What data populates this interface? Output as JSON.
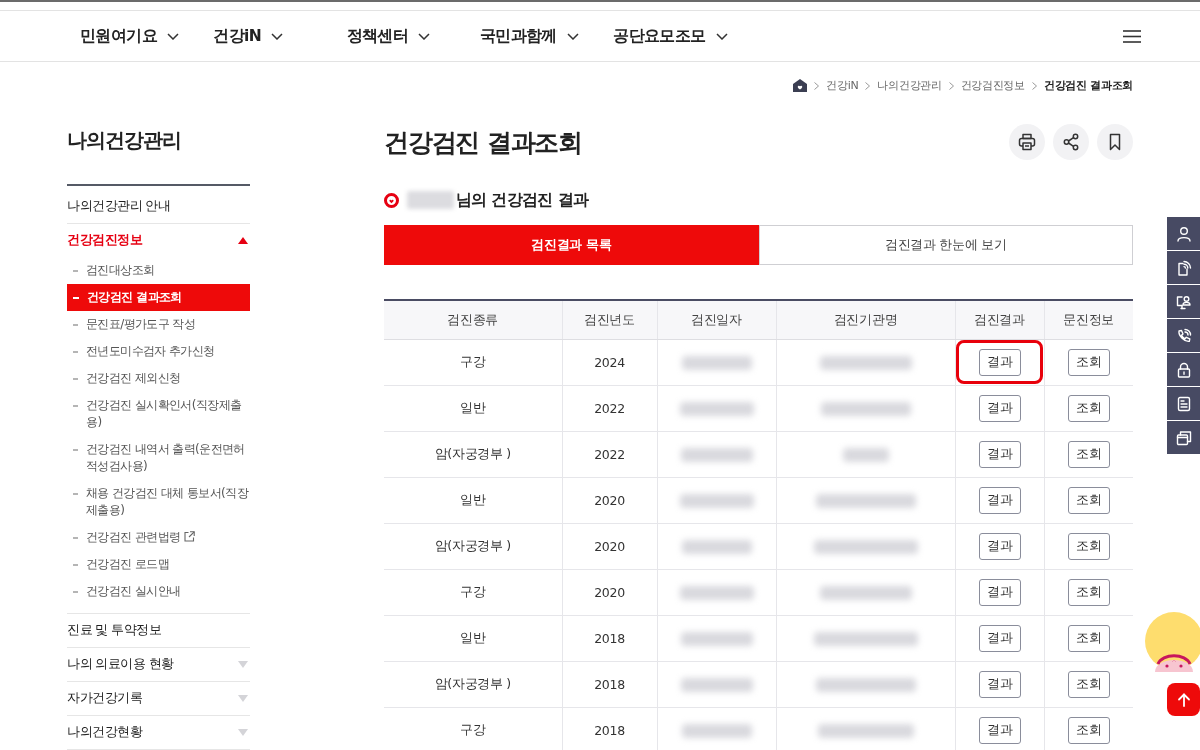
{
  "top_nav": {
    "items": [
      {
        "label": "민원여기요"
      },
      {
        "label": "건강iN"
      },
      {
        "label": "정책센터"
      },
      {
        "label": "국민과함께"
      },
      {
        "label": "공단요모조모"
      }
    ]
  },
  "breadcrumb": [
    {
      "label": "건강iN",
      "current": false
    },
    {
      "label": "나의건강관리",
      "current": false
    },
    {
      "label": "건강검진정보",
      "current": false
    },
    {
      "label": "건강검진 결과조회",
      "current": true
    }
  ],
  "sidebar": {
    "title": "나의건강관리",
    "items": [
      {
        "label": "나의건강관리 안내",
        "kind": "link",
        "selected": false
      },
      {
        "label": "건강검진정보",
        "kind": "group",
        "selected": true,
        "expanded": true,
        "children": [
          {
            "label": "검진대상조회",
            "selected": false,
            "external": false
          },
          {
            "label": "건강검진 결과조회",
            "selected": true,
            "external": false
          },
          {
            "label": "문진표/평가도구 작성",
            "selected": false,
            "external": false
          },
          {
            "label": "전년도미수검자 추가신청",
            "selected": false,
            "external": false
          },
          {
            "label": "건강검진 제외신청",
            "selected": false,
            "external": false
          },
          {
            "label": "건강검진 실시확인서(직장제출용)",
            "selected": false,
            "external": false
          },
          {
            "label": "건강검진 내역서 출력(운전면허적성검사용)",
            "selected": false,
            "external": false
          },
          {
            "label": "채용 건강검진 대체 통보서(직장제출용)",
            "selected": false,
            "external": false
          },
          {
            "label": "건강검진 관련법령",
            "selected": false,
            "external": true
          },
          {
            "label": "건강검진 로드맵",
            "selected": false,
            "external": false
          },
          {
            "label": "건강검진 실시안내",
            "selected": false,
            "external": false
          }
        ]
      },
      {
        "label": "진료 및 투약정보",
        "kind": "link",
        "selected": false
      },
      {
        "label": "나의 의료이용 현황",
        "kind": "group",
        "selected": false,
        "expanded": false
      },
      {
        "label": "자가건강기록",
        "kind": "group",
        "selected": false,
        "expanded": false
      },
      {
        "label": "나의건강현황",
        "kind": "group",
        "selected": false,
        "expanded": false
      }
    ]
  },
  "page": {
    "title": "건강검진 결과조회"
  },
  "result_heading": {
    "name_redacted": true,
    "text": "님의 건강검진 결과"
  },
  "tabs": [
    {
      "label": "검진결과 목록",
      "selected": true
    },
    {
      "label": "검진결과 한눈에 보기",
      "selected": false
    }
  ],
  "table": {
    "columns": [
      {
        "label": "검진종류"
      },
      {
        "label": "검진년도"
      },
      {
        "label": "검진일자",
        "redacted": true
      },
      {
        "label": "검진기관명",
        "redacted": true
      },
      {
        "label": "검진결과"
      },
      {
        "label": "문진정보"
      }
    ],
    "rows": [
      {
        "type": "구강",
        "year": "2024",
        "result": "결과",
        "inquiry": "조회",
        "highlighted": true
      },
      {
        "type": "일반",
        "year": "2022",
        "result": "결과",
        "inquiry": "조회",
        "highlighted": false
      },
      {
        "type": "암(자궁경부 )",
        "year": "2022",
        "result": "결과",
        "inquiry": "조회",
        "highlighted": false
      },
      {
        "type": "일반",
        "year": "2020",
        "result": "결과",
        "inquiry": "조회",
        "highlighted": false
      },
      {
        "type": "암(자궁경부 )",
        "year": "2020",
        "result": "결과",
        "inquiry": "조회",
        "highlighted": false
      },
      {
        "type": "구강",
        "year": "2020",
        "result": "결과",
        "inquiry": "조회",
        "highlighted": false
      },
      {
        "type": "일반",
        "year": "2018",
        "result": "결과",
        "inquiry": "조회",
        "highlighted": false
      },
      {
        "type": "암(자궁경부 )",
        "year": "2018",
        "result": "결과",
        "inquiry": "조회",
        "highlighted": false
      },
      {
        "type": "구강",
        "year": "2018",
        "result": "결과",
        "inquiry": "조회",
        "highlighted": false
      }
    ]
  }
}
